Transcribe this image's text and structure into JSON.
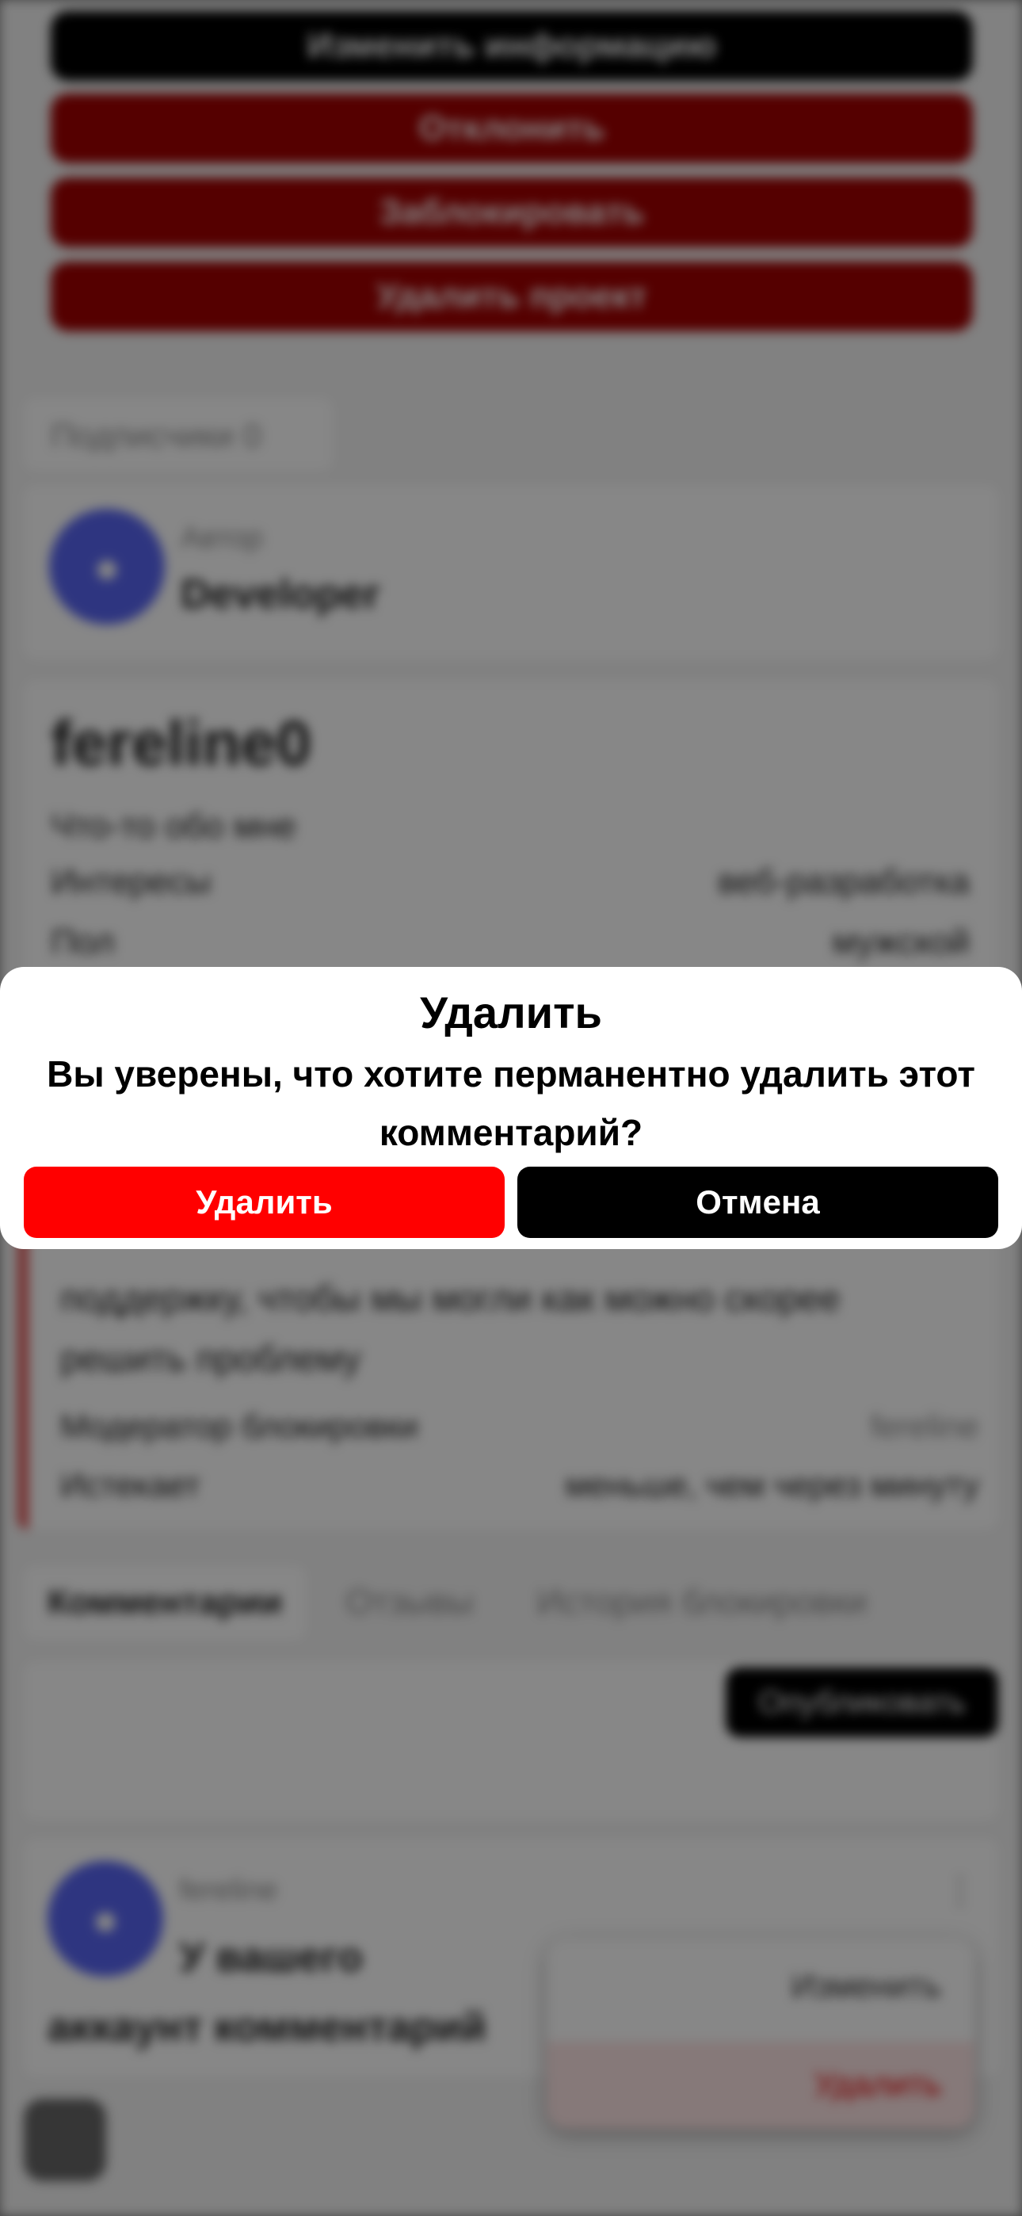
{
  "modal": {
    "title": "Удалить",
    "message": "Вы уверены, что хотите перманентно удалить этот комментарий?",
    "confirm_label": "Удалить",
    "cancel_label": "Отмена"
  },
  "background": {
    "top_buttons": [
      "Изменить информацию",
      "Отклонить",
      "Заблокировать",
      "Удалить проект"
    ],
    "section_tab": "Подписчики 0",
    "author": {
      "role": "Автор",
      "name": "Developer"
    },
    "profile": {
      "title": "fereline0",
      "subtitle": "Что-то обо мне",
      "rows": [
        {
          "label": "Интересы",
          "value": "веб-разработка"
        },
        {
          "label": "Пол",
          "value": "мужской"
        }
      ]
    },
    "notice": {
      "text": "поддержку, чтобы мы могли как можно скорее решить проблему",
      "rows": [
        {
          "label": "Модератор блокировки",
          "value": "fereline"
        },
        {
          "label": "Истекает",
          "value": "меньше, чем через минуту"
        }
      ]
    },
    "tabs": [
      "Комментарии",
      "Отзывы",
      "История блокировки"
    ],
    "publish_label": "Опубликовать",
    "comment": {
      "author": "fereline",
      "text": "У вашего аккаунт комментарий"
    },
    "context_menu": {
      "edit_label": "Изменить",
      "delete_label": "Удалить"
    }
  },
  "colors": {
    "accent_red": "#ff0000",
    "dark_red": "#8b0000",
    "black": "#000000",
    "avatar_blue": "#5865f2"
  }
}
